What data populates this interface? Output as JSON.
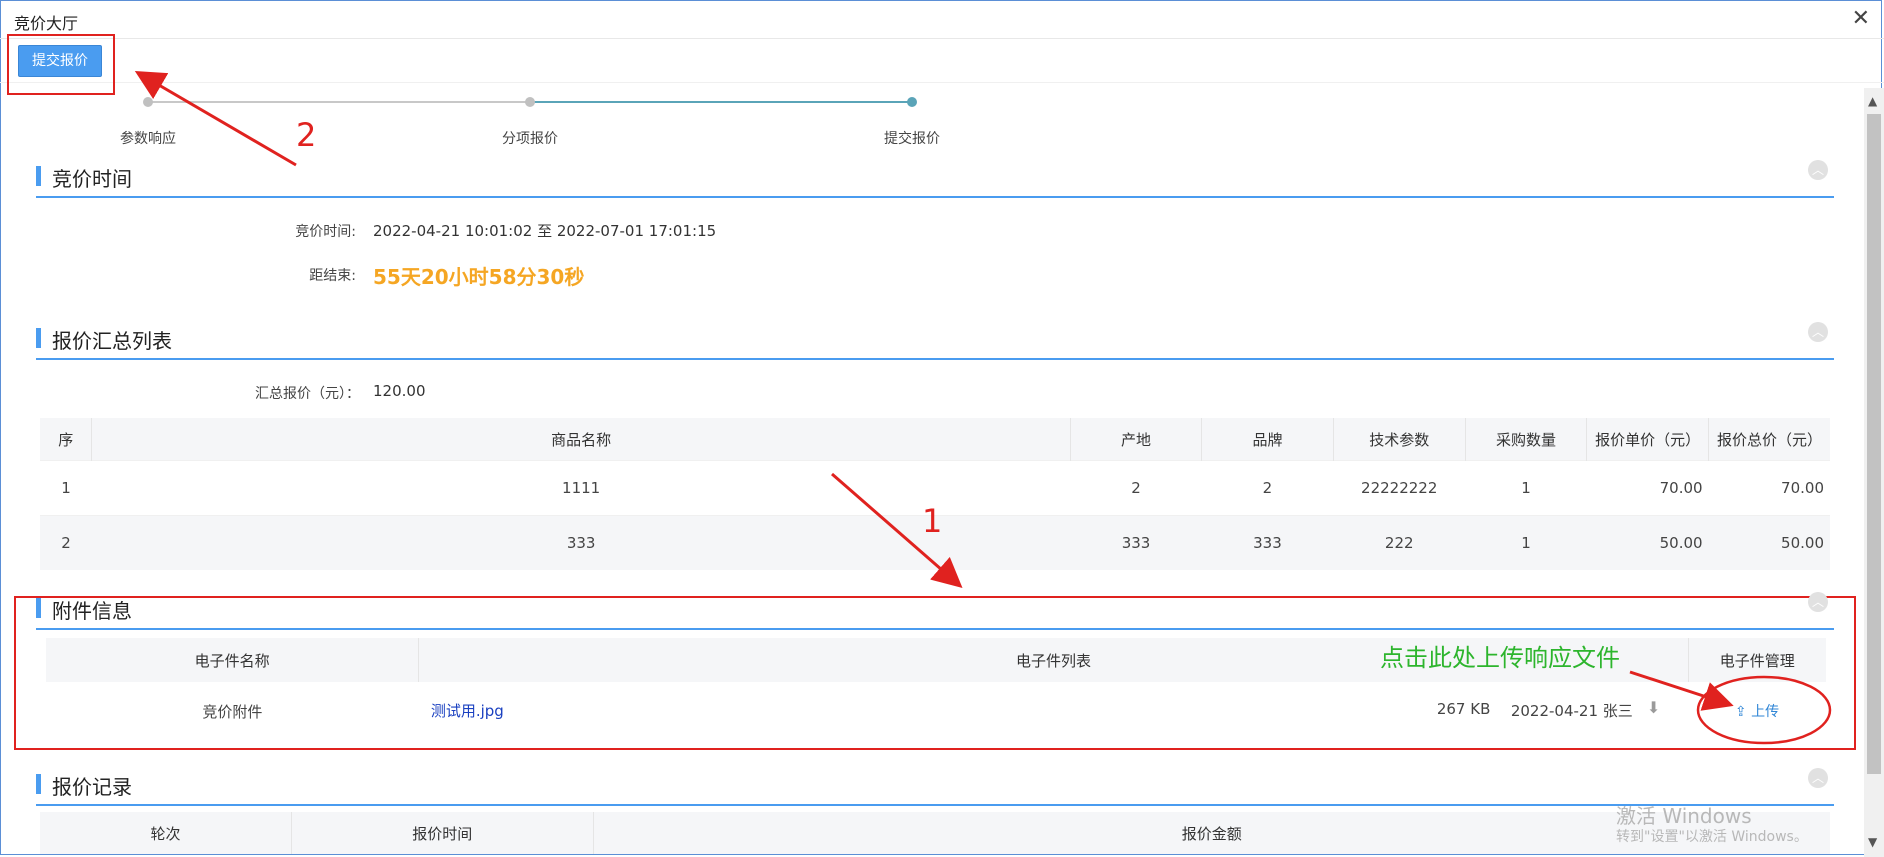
{
  "window": {
    "title": "竞价大厅"
  },
  "toolbar": {
    "submit_label": "提交报价"
  },
  "steps": [
    "参数响应",
    "分项报价",
    "提交报价"
  ],
  "sections": {
    "time": "竞价时间",
    "summary": "报价汇总列表",
    "attach": "附件信息",
    "records": "报价记录"
  },
  "time": {
    "range_label": "竞价时间:",
    "range_value": "2022-04-21 10:01:02 至 2022-07-01 17:01:15",
    "remaining_label": "距结束:",
    "remaining_value": "55天20小时58分30秒"
  },
  "summary": {
    "total_label": "汇总报价（元）：",
    "total_value": "120.00",
    "columns": [
      "序",
      "商品名称",
      "产地",
      "品牌",
      "技术参数",
      "采购数量",
      "报价单价（元）",
      "报价总价（元）"
    ],
    "rows": [
      [
        "1",
        "1111",
        "2",
        "2",
        "22222222",
        "1",
        "70.00",
        "70.00"
      ],
      [
        "2",
        "333",
        "333",
        "333",
        "222",
        "1",
        "50.00",
        "50.00"
      ]
    ]
  },
  "attach": {
    "columns": [
      "电子件名称",
      "电子件列表",
      "电子件管理"
    ],
    "row": {
      "name": "竞价附件",
      "file": "测试用.jpg",
      "size": "267 KB",
      "date_user": "2022-04-21 张三",
      "upload_label": "上传"
    }
  },
  "records": {
    "columns": [
      "轮次",
      "报价时间",
      "报价金额"
    ]
  },
  "annotations": {
    "num1": "1",
    "num2": "2",
    "note": "点击此处上传响应文件"
  },
  "watermark": {
    "line1": "激活 Windows",
    "line2": "转到\"设置\"以激活 Windows。"
  },
  "colors": {
    "primary": "#4a9cf0",
    "countdown": "#f5a623",
    "annotation_red": "#e0221f",
    "note_green": "#2db52d",
    "step_active": "#5aa4b8"
  }
}
